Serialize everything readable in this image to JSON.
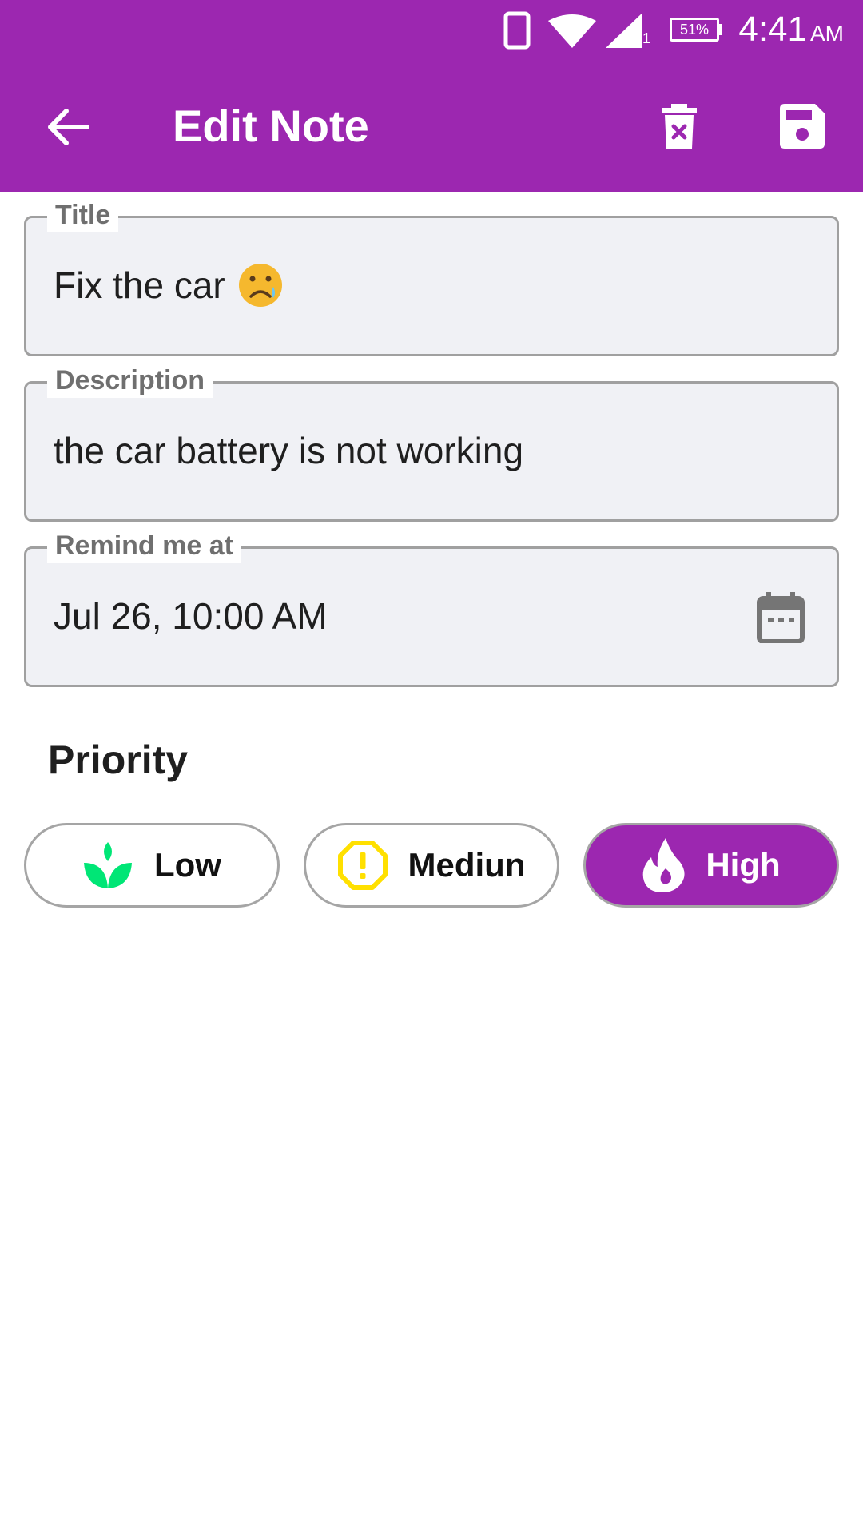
{
  "status_bar": {
    "battery": "51%",
    "time": "4:41",
    "ampm": "AM",
    "signal_sim": "1"
  },
  "app_bar": {
    "title": "Edit Note",
    "background_color": "#9c27b0",
    "icons": [
      "back-arrow-icon",
      "delete-icon",
      "save-icon"
    ]
  },
  "form": {
    "title": {
      "label": "Title",
      "value": "Fix the car",
      "emoji": "😥"
    },
    "description": {
      "label": "Description",
      "value": "the car battery is not working"
    },
    "remind": {
      "label": "Remind me at",
      "value": "Jul 26, 10:00 AM",
      "icon": "calendar-icon"
    }
  },
  "priority": {
    "heading": "Priority",
    "options": [
      {
        "label": "Low",
        "icon": "sprout-icon",
        "icon_color": "#00e676",
        "selected": false
      },
      {
        "label": "Mediun",
        "icon": "warning-octagon-icon",
        "icon_color": "#ffe000",
        "selected": false
      },
      {
        "label": "High",
        "icon": "flame-icon",
        "icon_color": "#ffffff",
        "selected": true
      }
    ],
    "selected_color": "#9c27b0"
  }
}
